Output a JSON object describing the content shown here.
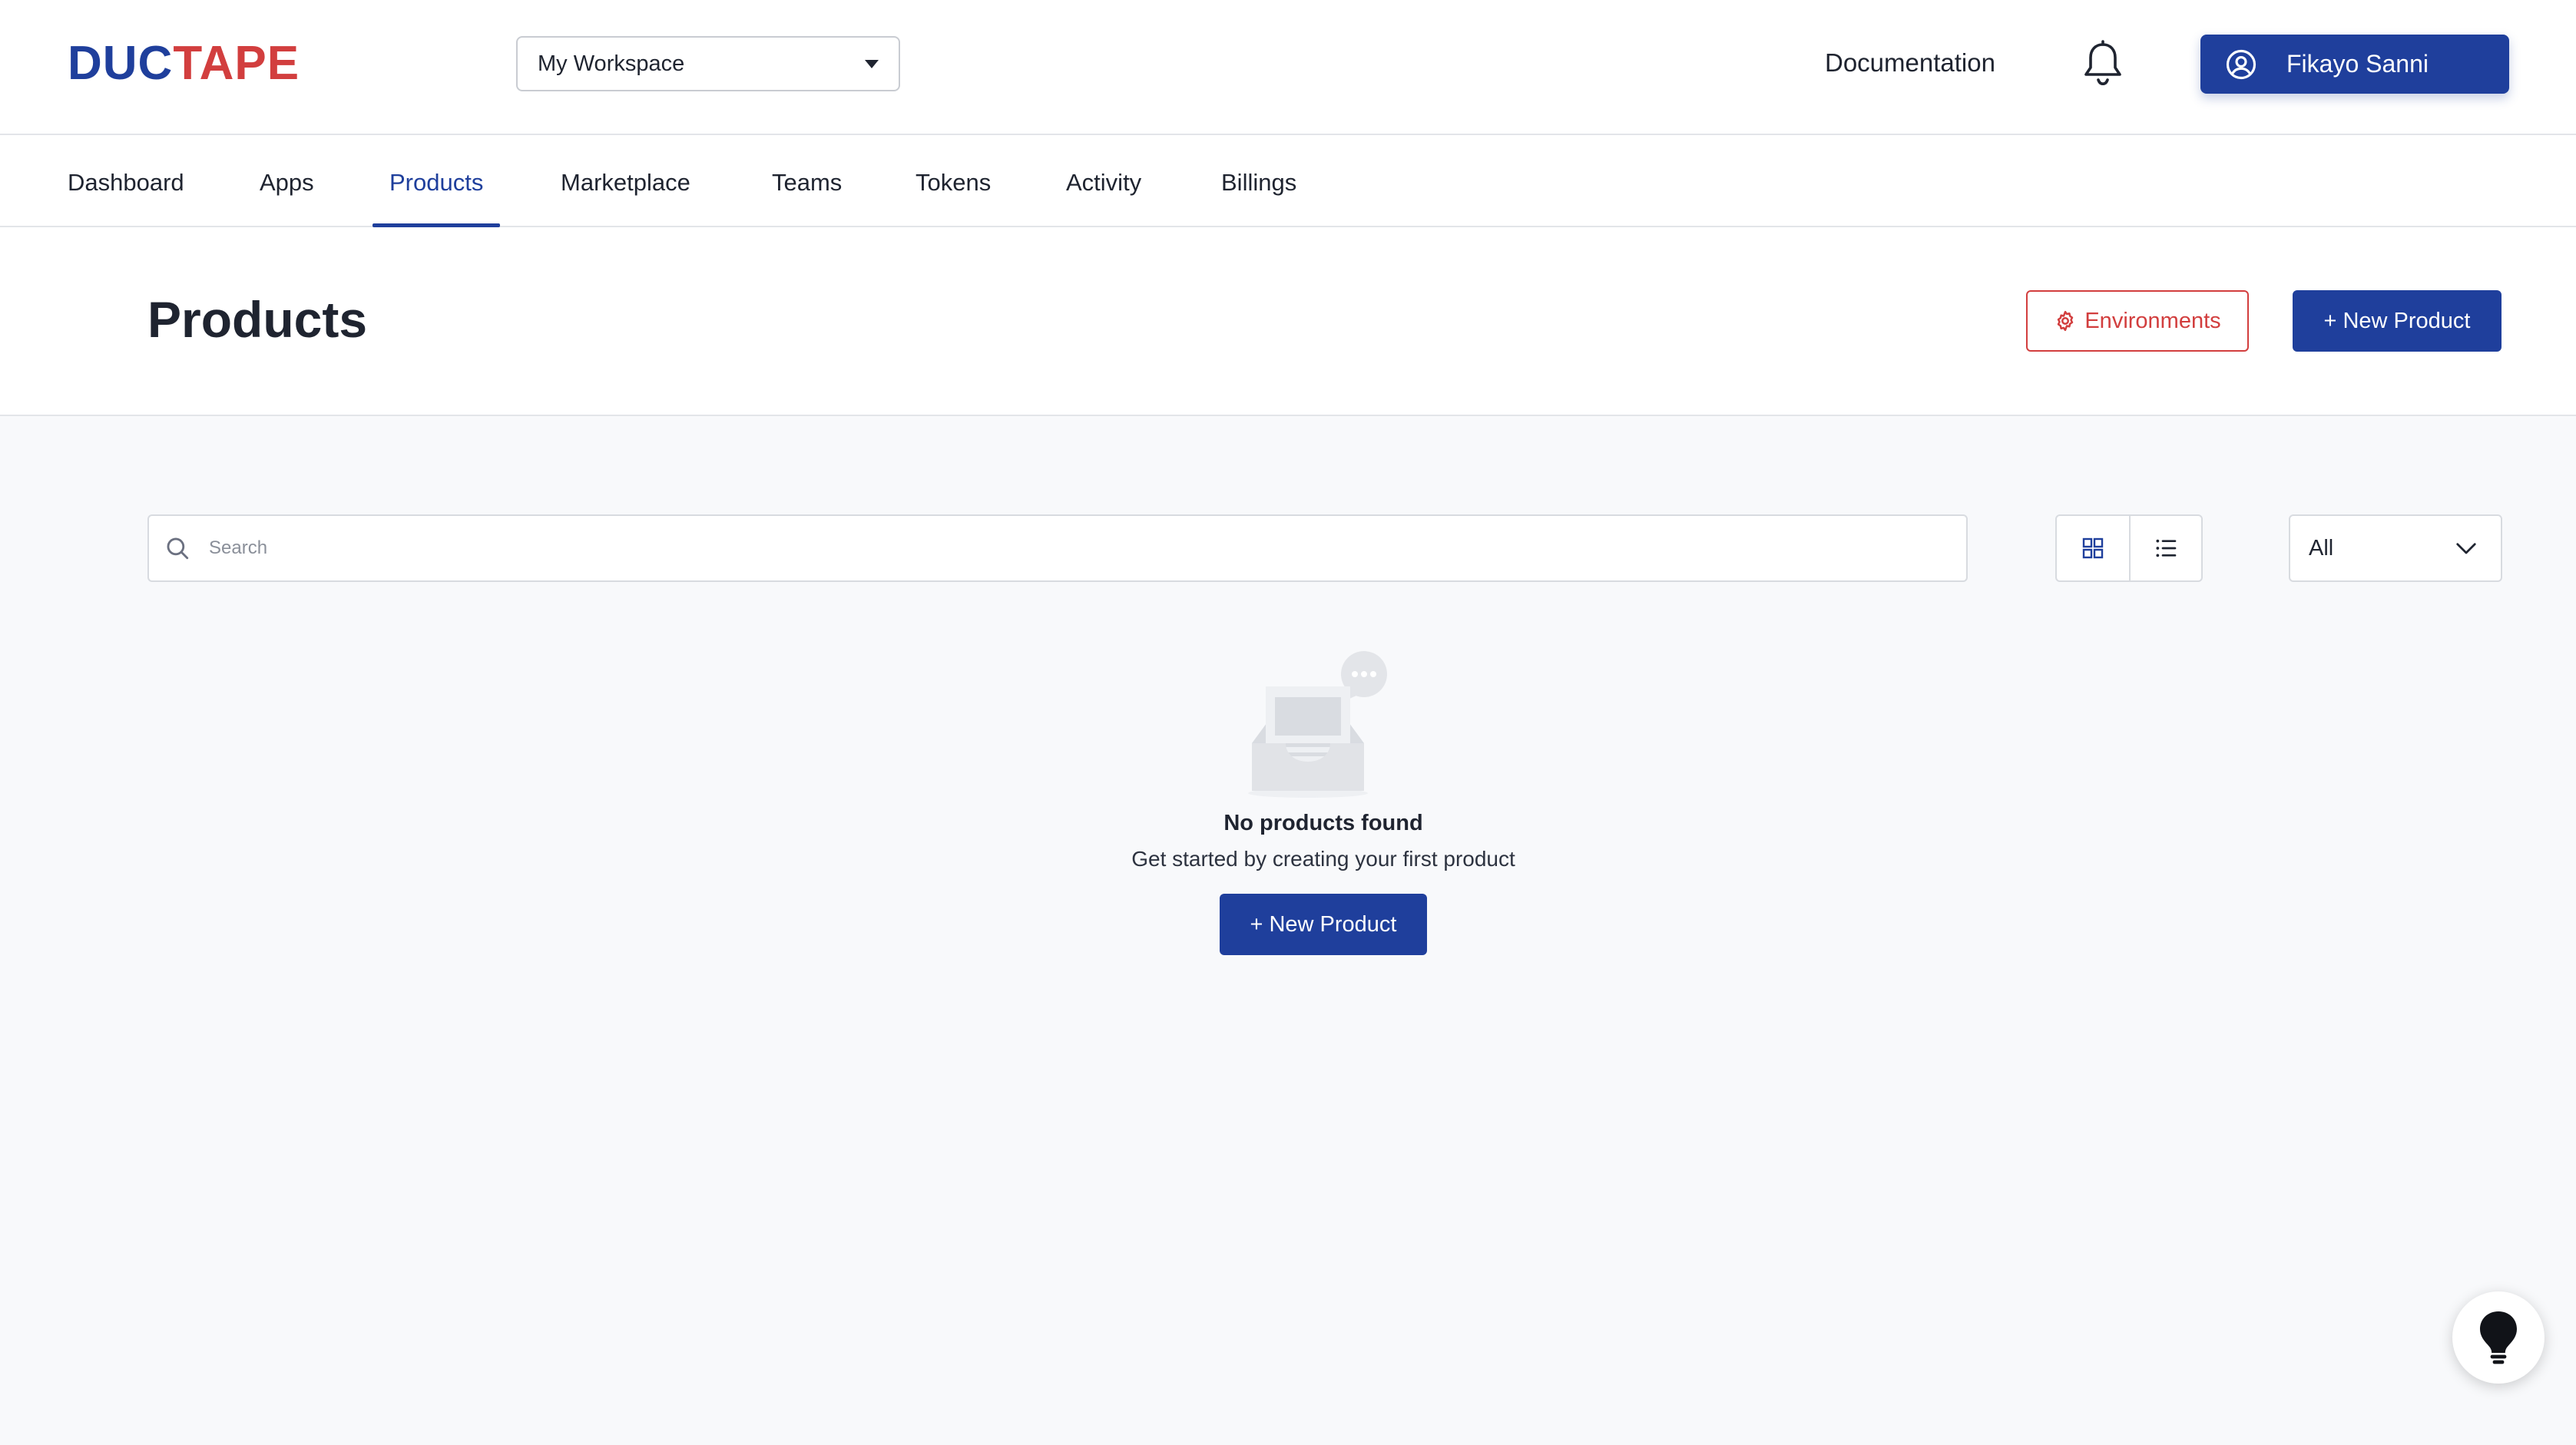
{
  "brand": {
    "part1": "DUC",
    "part2": "TAPE",
    "primary_color": "#1f3f9c",
    "accent_color": "#d23e3e"
  },
  "workspace": {
    "selected": "My Workspace",
    "icon": "caret-down-icon"
  },
  "topnav": {
    "documentation": "Documentation",
    "notifications_icon": "bell-icon",
    "user_name": "Fikayo Sanni",
    "user_icon": "user-circle-icon"
  },
  "tabs": [
    {
      "label": "Dashboard"
    },
    {
      "label": "Apps"
    },
    {
      "label": "Products",
      "active": true
    },
    {
      "label": "Marketplace"
    },
    {
      "label": "Teams"
    },
    {
      "label": "Tokens"
    },
    {
      "label": "Activity"
    },
    {
      "label": "Billings"
    }
  ],
  "header": {
    "title": "Products",
    "environments_label": "Environments",
    "environments_icon": "gear-icon",
    "new_product_label": "+ New Product"
  },
  "toolbar": {
    "search_placeholder": "Search",
    "search_icon": "search-icon",
    "grid_view_icon": "grid-view-icon",
    "list_view_icon": "list-view-icon",
    "filter_value": "All",
    "filter_icon": "chevron-down-icon"
  },
  "empty_state": {
    "title": "No products found",
    "subtitle": "Get started by creating your first product",
    "button_label": "+ New Product",
    "illustration": "empty-inbox-illustration"
  },
  "help": {
    "icon": "lightbulb-icon"
  }
}
